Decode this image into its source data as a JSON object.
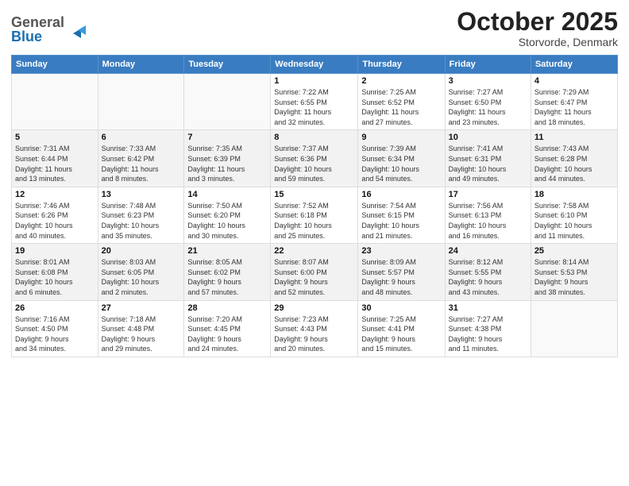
{
  "header": {
    "logo_line1": "General",
    "logo_line2": "Blue",
    "month": "October 2025",
    "location": "Storvorde, Denmark"
  },
  "weekdays": [
    "Sunday",
    "Monday",
    "Tuesday",
    "Wednesday",
    "Thursday",
    "Friday",
    "Saturday"
  ],
  "weeks": [
    [
      {
        "day": "",
        "info": ""
      },
      {
        "day": "",
        "info": ""
      },
      {
        "day": "",
        "info": ""
      },
      {
        "day": "1",
        "info": "Sunrise: 7:22 AM\nSunset: 6:55 PM\nDaylight: 11 hours\nand 32 minutes."
      },
      {
        "day": "2",
        "info": "Sunrise: 7:25 AM\nSunset: 6:52 PM\nDaylight: 11 hours\nand 27 minutes."
      },
      {
        "day": "3",
        "info": "Sunrise: 7:27 AM\nSunset: 6:50 PM\nDaylight: 11 hours\nand 23 minutes."
      },
      {
        "day": "4",
        "info": "Sunrise: 7:29 AM\nSunset: 6:47 PM\nDaylight: 11 hours\nand 18 minutes."
      }
    ],
    [
      {
        "day": "5",
        "info": "Sunrise: 7:31 AM\nSunset: 6:44 PM\nDaylight: 11 hours\nand 13 minutes."
      },
      {
        "day": "6",
        "info": "Sunrise: 7:33 AM\nSunset: 6:42 PM\nDaylight: 11 hours\nand 8 minutes."
      },
      {
        "day": "7",
        "info": "Sunrise: 7:35 AM\nSunset: 6:39 PM\nDaylight: 11 hours\nand 3 minutes."
      },
      {
        "day": "8",
        "info": "Sunrise: 7:37 AM\nSunset: 6:36 PM\nDaylight: 10 hours\nand 59 minutes."
      },
      {
        "day": "9",
        "info": "Sunrise: 7:39 AM\nSunset: 6:34 PM\nDaylight: 10 hours\nand 54 minutes."
      },
      {
        "day": "10",
        "info": "Sunrise: 7:41 AM\nSunset: 6:31 PM\nDaylight: 10 hours\nand 49 minutes."
      },
      {
        "day": "11",
        "info": "Sunrise: 7:43 AM\nSunset: 6:28 PM\nDaylight: 10 hours\nand 44 minutes."
      }
    ],
    [
      {
        "day": "12",
        "info": "Sunrise: 7:46 AM\nSunset: 6:26 PM\nDaylight: 10 hours\nand 40 minutes."
      },
      {
        "day": "13",
        "info": "Sunrise: 7:48 AM\nSunset: 6:23 PM\nDaylight: 10 hours\nand 35 minutes."
      },
      {
        "day": "14",
        "info": "Sunrise: 7:50 AM\nSunset: 6:20 PM\nDaylight: 10 hours\nand 30 minutes."
      },
      {
        "day": "15",
        "info": "Sunrise: 7:52 AM\nSunset: 6:18 PM\nDaylight: 10 hours\nand 25 minutes."
      },
      {
        "day": "16",
        "info": "Sunrise: 7:54 AM\nSunset: 6:15 PM\nDaylight: 10 hours\nand 21 minutes."
      },
      {
        "day": "17",
        "info": "Sunrise: 7:56 AM\nSunset: 6:13 PM\nDaylight: 10 hours\nand 16 minutes."
      },
      {
        "day": "18",
        "info": "Sunrise: 7:58 AM\nSunset: 6:10 PM\nDaylight: 10 hours\nand 11 minutes."
      }
    ],
    [
      {
        "day": "19",
        "info": "Sunrise: 8:01 AM\nSunset: 6:08 PM\nDaylight: 10 hours\nand 6 minutes."
      },
      {
        "day": "20",
        "info": "Sunrise: 8:03 AM\nSunset: 6:05 PM\nDaylight: 10 hours\nand 2 minutes."
      },
      {
        "day": "21",
        "info": "Sunrise: 8:05 AM\nSunset: 6:02 PM\nDaylight: 9 hours\nand 57 minutes."
      },
      {
        "day": "22",
        "info": "Sunrise: 8:07 AM\nSunset: 6:00 PM\nDaylight: 9 hours\nand 52 minutes."
      },
      {
        "day": "23",
        "info": "Sunrise: 8:09 AM\nSunset: 5:57 PM\nDaylight: 9 hours\nand 48 minutes."
      },
      {
        "day": "24",
        "info": "Sunrise: 8:12 AM\nSunset: 5:55 PM\nDaylight: 9 hours\nand 43 minutes."
      },
      {
        "day": "25",
        "info": "Sunrise: 8:14 AM\nSunset: 5:53 PM\nDaylight: 9 hours\nand 38 minutes."
      }
    ],
    [
      {
        "day": "26",
        "info": "Sunrise: 7:16 AM\nSunset: 4:50 PM\nDaylight: 9 hours\nand 34 minutes."
      },
      {
        "day": "27",
        "info": "Sunrise: 7:18 AM\nSunset: 4:48 PM\nDaylight: 9 hours\nand 29 minutes."
      },
      {
        "day": "28",
        "info": "Sunrise: 7:20 AM\nSunset: 4:45 PM\nDaylight: 9 hours\nand 24 minutes."
      },
      {
        "day": "29",
        "info": "Sunrise: 7:23 AM\nSunset: 4:43 PM\nDaylight: 9 hours\nand 20 minutes."
      },
      {
        "day": "30",
        "info": "Sunrise: 7:25 AM\nSunset: 4:41 PM\nDaylight: 9 hours\nand 15 minutes."
      },
      {
        "day": "31",
        "info": "Sunrise: 7:27 AM\nSunset: 4:38 PM\nDaylight: 9 hours\nand 11 minutes."
      },
      {
        "day": "",
        "info": ""
      }
    ]
  ]
}
